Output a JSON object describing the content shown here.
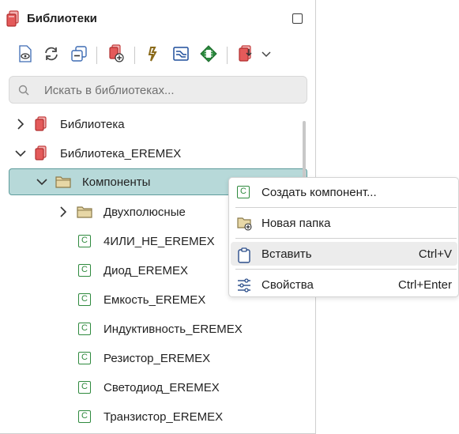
{
  "panel": {
    "title": "Библиотеки",
    "title_icon": "libraries-icon",
    "maximize_icon": "maximize-icon"
  },
  "toolbar": {
    "buttons": [
      {
        "name": "view-icon"
      },
      {
        "name": "refresh-icon"
      },
      {
        "name": "collapse-all-icon"
      },
      {
        "name": "add-library-icon"
      },
      {
        "name": "link-icon"
      },
      {
        "name": "symbol-editor-icon"
      },
      {
        "name": "component-chip-icon"
      },
      {
        "name": "import-icon"
      },
      {
        "name": "chevron-down-icon"
      }
    ]
  },
  "search": {
    "placeholder": "Искать в библиотеках..."
  },
  "tree": {
    "library1": "Библиотека",
    "library2": "Библиотека_EREMEX",
    "folder_components": "Компоненты",
    "folder_two_terminal": "Двухполюсные",
    "items": [
      "4ИЛИ_НЕ_EREMEX",
      "Диод_EREMEX",
      "Емкость_EREMEX",
      "Индуктивность_EREMEX",
      "Резистор_EREMEX",
      "Светодиод_EREMEX",
      "Транзистор_EREMEX"
    ]
  },
  "context_menu": {
    "create_component": "Создать компонент...",
    "new_folder": "Новая папка",
    "paste": "Вставить",
    "paste_shortcut": "Ctrl+V",
    "properties": "Свойства",
    "properties_shortcut": "Ctrl+Enter"
  },
  "colors": {
    "selection": "#b7d9d9",
    "selection_border": "#5f9c9c",
    "component_green": "#2f8a3e",
    "library_red": "#d24a4a",
    "folder": "#e7d7a6"
  }
}
